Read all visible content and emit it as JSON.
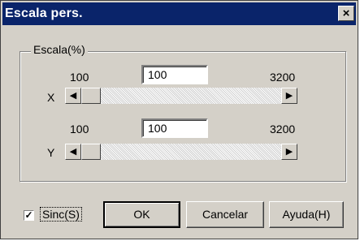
{
  "window": {
    "title": "Escala pers.",
    "close_glyph": "×"
  },
  "group": {
    "label": "Escala(%)",
    "x": {
      "axis_label": "X",
      "min": "100",
      "max": "3200",
      "value": "100",
      "level_fraction": 0.0
    },
    "y": {
      "axis_label": "Y",
      "min": "100",
      "max": "3200",
      "value": "100",
      "level_fraction": 0.0
    }
  },
  "sync": {
    "label": "Sinc(S)",
    "checked": true,
    "check_glyph": "✓"
  },
  "buttons": {
    "ok": "OK",
    "cancel": "Cancelar",
    "help": "Ayuda(H)"
  },
  "icons": {
    "left": "left-arrow-icon",
    "right": "right-arrow-icon",
    "close": "close-icon"
  },
  "colors": {
    "titlebar": "#0a246a",
    "face": "#d4d0c8"
  }
}
